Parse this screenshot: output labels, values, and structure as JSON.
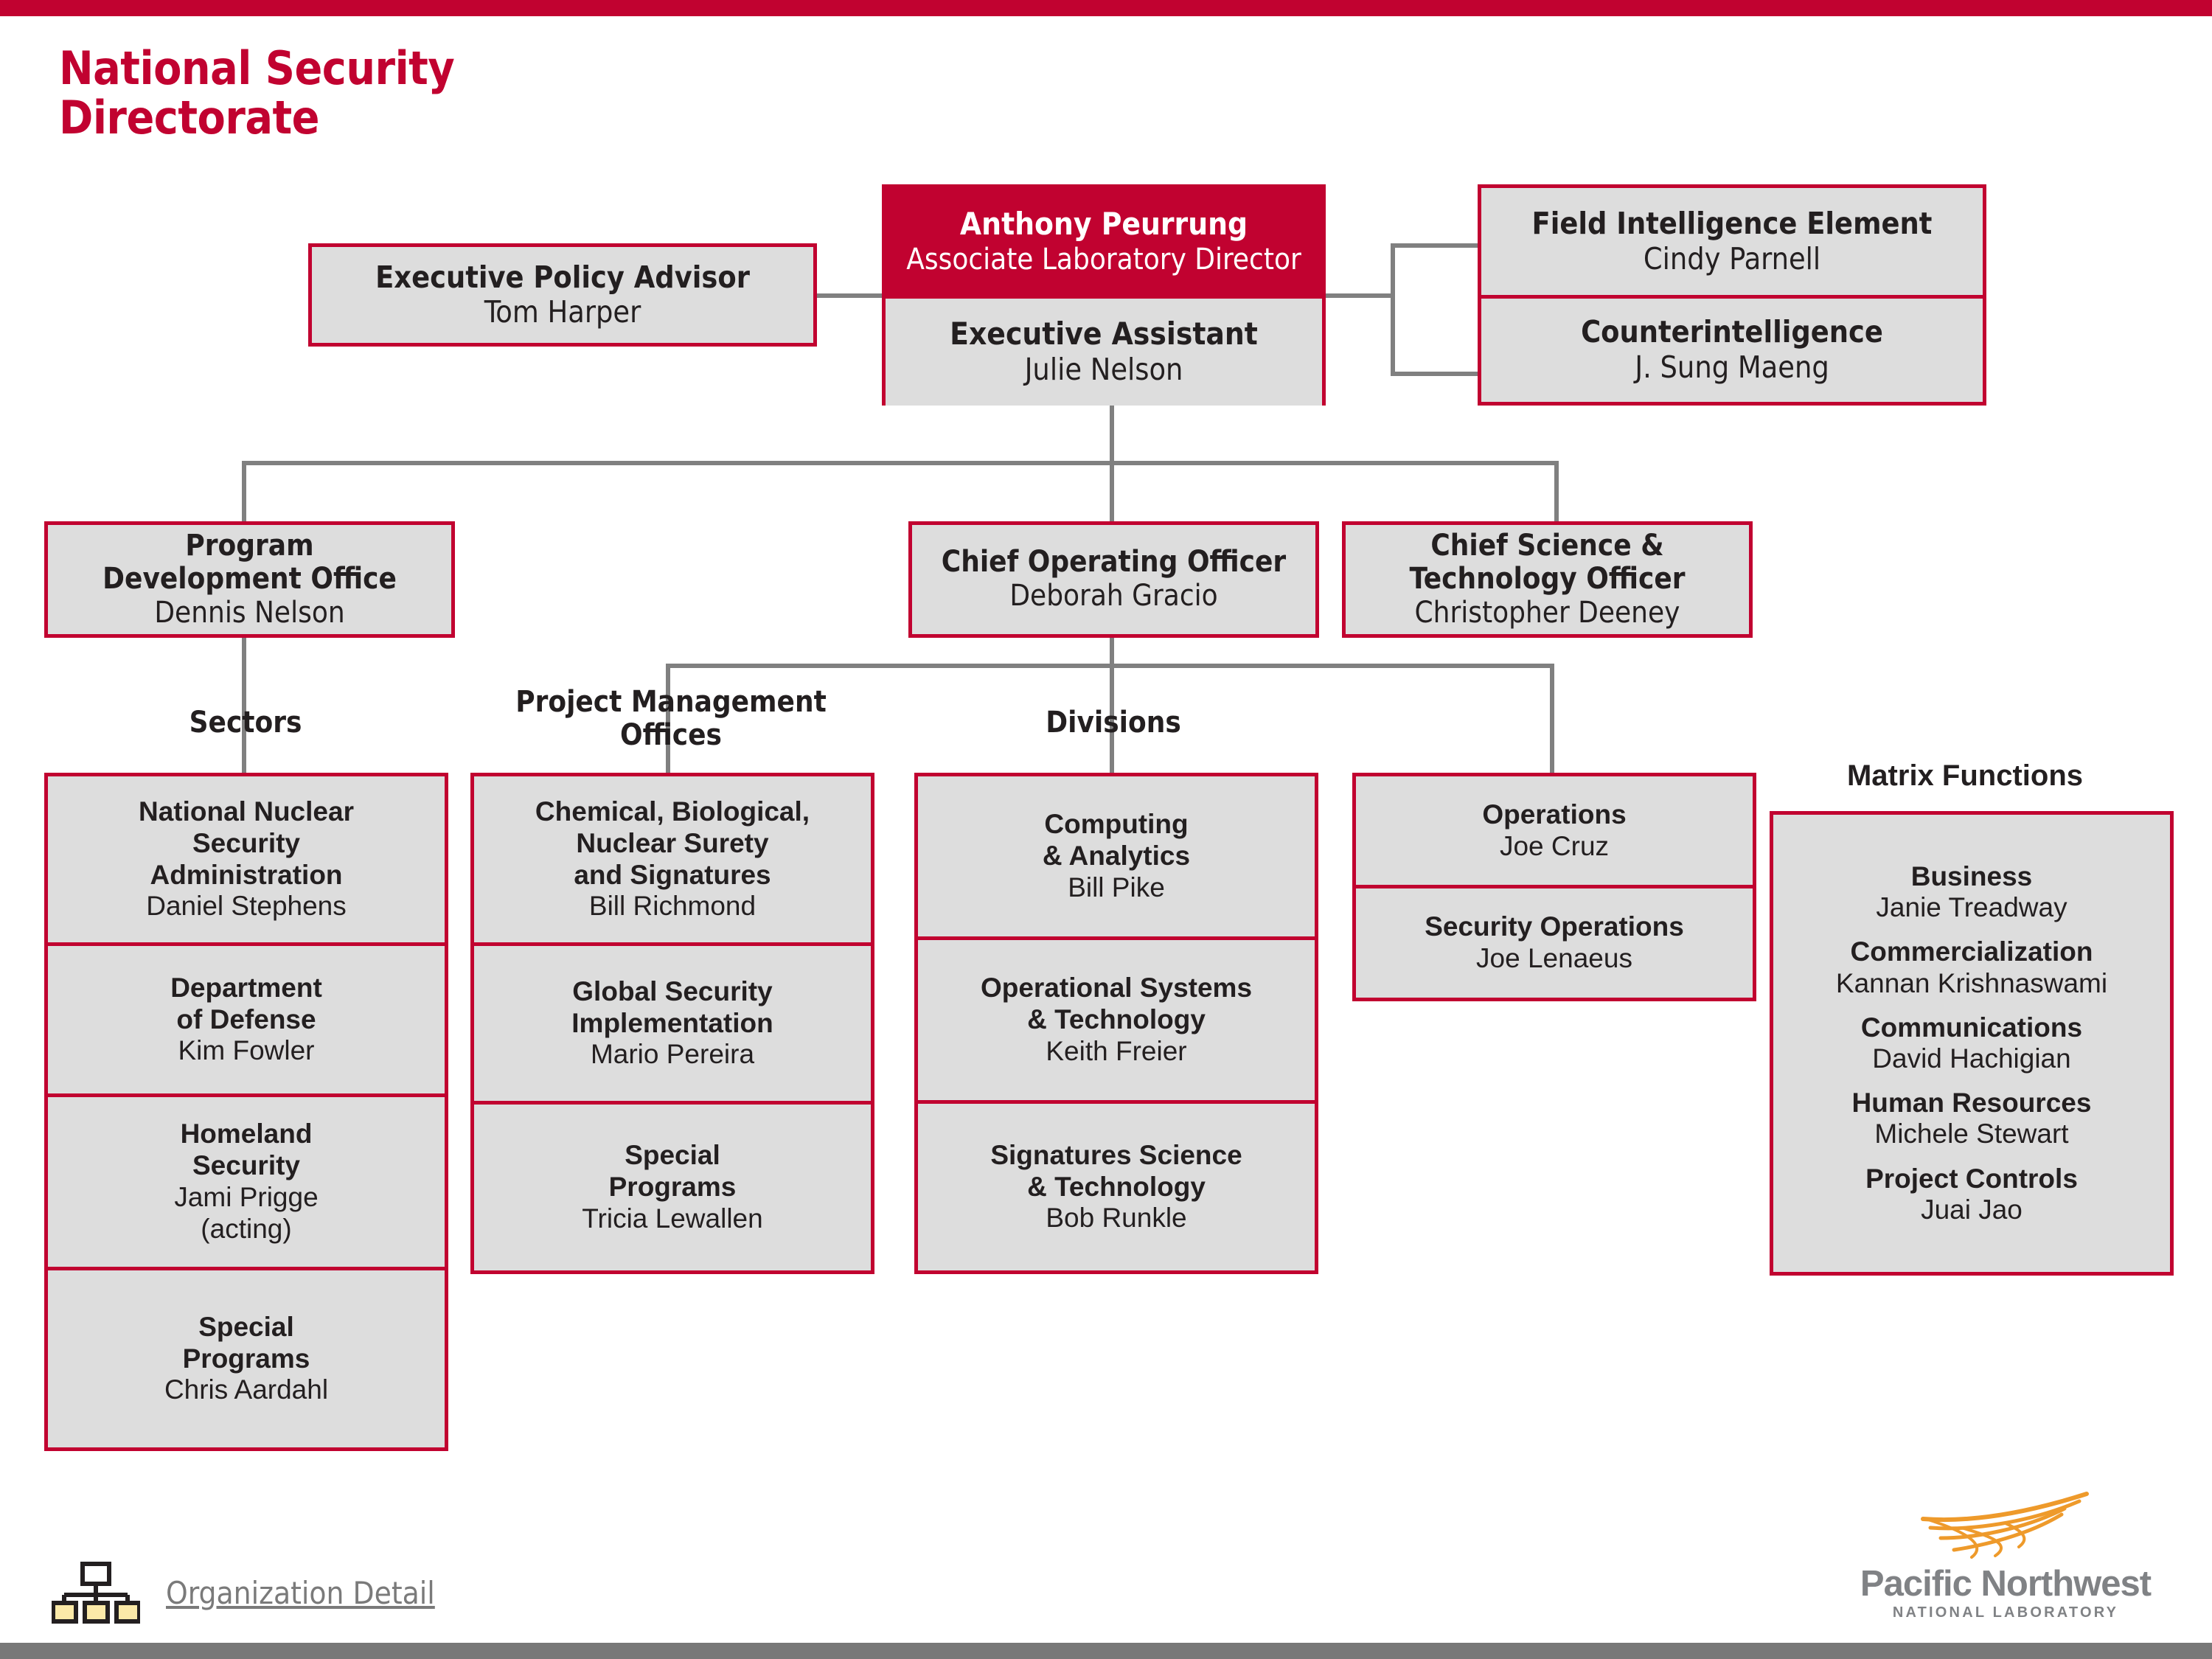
{
  "theme": {
    "accent": "#C10230",
    "box_fill": "#DDDDDD",
    "line": "#808080",
    "logo_orange": "#EE9A2B",
    "logo_gray": "#808285"
  },
  "title": "National Security\nDirectorate",
  "title_line1": "National Security",
  "title_line2": "Directorate",
  "head": {
    "director_title": "Anthony Peurrung",
    "director_role": "Associate Laboratory Director",
    "assistant_title": "Executive Assistant",
    "assistant_name": "Julie Nelson"
  },
  "advisor": {
    "title": "Executive Policy Advisor",
    "name": "Tom Harper"
  },
  "intel": [
    {
      "title": "Field Intelligence Element",
      "name": "Cindy Parnell"
    },
    {
      "title": "Counterintelligence",
      "name": "J. Sung Maeng"
    }
  ],
  "tier2": [
    {
      "title": "Program\nDevelopment Office",
      "title_l1": "Program",
      "title_l2": "Development Office",
      "name": "Dennis Nelson"
    },
    {
      "title": "Chief Operating Officer",
      "title_l1": "Chief Operating Officer",
      "title_l2": "",
      "name": "Deborah Gracio"
    },
    {
      "title": "Chief Science &\nTechnology Officer",
      "title_l1": "Chief Science &",
      "title_l2": "Technology Officer",
      "name": "Christopher Deeney"
    }
  ],
  "captions": {
    "sectors": "Sectors",
    "pmo_l1": "Project Management",
    "pmo_l2": "Offices",
    "divisions": "Divisions",
    "matrix": "Matrix Functions"
  },
  "sectors": [
    {
      "lines": [
        "National Nuclear",
        "Security",
        "Administration"
      ],
      "name": "Daniel Stephens"
    },
    {
      "lines": [
        "Department",
        "of Defense"
      ],
      "name": "Kim Fowler"
    },
    {
      "lines": [
        "Homeland",
        "Security"
      ],
      "name": "Jami Prigge",
      "name2": "(acting)"
    },
    {
      "lines": [
        "Special",
        "Programs"
      ],
      "name": "Chris Aardahl"
    }
  ],
  "pmo": [
    {
      "lines": [
        "Chemical, Biological,",
        "Nuclear Surety",
        "and Signatures"
      ],
      "name": "Bill Richmond"
    },
    {
      "lines": [
        "Global Security",
        "Implementation"
      ],
      "name": "Mario Pereira"
    },
    {
      "lines": [
        "Special",
        "Programs"
      ],
      "name": "Tricia Lewallen"
    }
  ],
  "divisions": [
    {
      "lines": [
        "Computing",
        "& Analytics"
      ],
      "name": "Bill Pike"
    },
    {
      "lines": [
        "Operational Systems",
        "& Technology"
      ],
      "name": "Keith Freier"
    },
    {
      "lines": [
        "Signatures Science",
        "& Technology"
      ],
      "name": "Bob Runkle"
    }
  ],
  "operations": [
    {
      "lines": [
        "Operations"
      ],
      "name": "Joe Cruz"
    },
    {
      "lines": [
        "Security Operations"
      ],
      "name": "Joe Lenaeus"
    }
  ],
  "matrix_functions": [
    {
      "title": "Business",
      "name": "Janie Treadway"
    },
    {
      "title": "Commercialization",
      "name": "Kannan Krishnaswami"
    },
    {
      "title": "Communications",
      "name": "David Hachigian"
    },
    {
      "title": "Human Resources",
      "name": "Michele Stewart"
    },
    {
      "title": "Project Controls",
      "name": "Juai Jao"
    }
  ],
  "footer": {
    "link_label": "Organization Detail",
    "logo_name": "Pacific Northwest",
    "logo_sub": "NATIONAL LABORATORY"
  }
}
